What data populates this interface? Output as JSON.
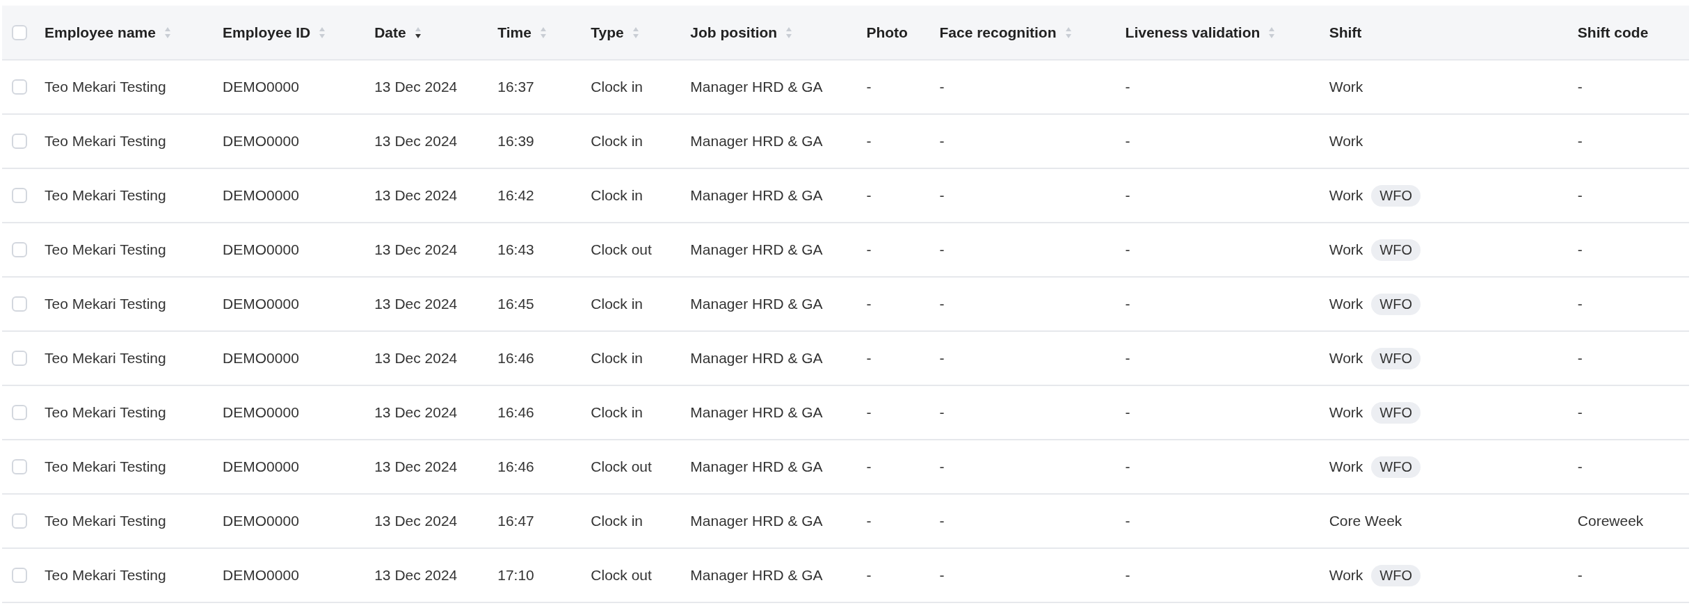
{
  "table": {
    "all_selected": false,
    "columns": [
      {
        "label": "Employee name",
        "kind": "text",
        "sortable": true,
        "sorted": false
      },
      {
        "label": "Employee ID",
        "kind": "text",
        "sortable": true,
        "sorted": false
      },
      {
        "label": "Date",
        "kind": "text",
        "sortable": true,
        "sorted": true
      },
      {
        "label": "Time",
        "kind": "text",
        "sortable": true,
        "sorted": false
      },
      {
        "label": "Type",
        "kind": "text",
        "sortable": true,
        "sorted": false
      },
      {
        "label": "Job position",
        "kind": "text",
        "sortable": true,
        "sorted": false
      },
      {
        "label": "Photo",
        "kind": "text",
        "sortable": false
      },
      {
        "label": "Face recognition",
        "kind": "text",
        "sortable": true,
        "sorted": false
      },
      {
        "label": "Liveness validation",
        "kind": "text",
        "sortable": true,
        "sorted": false
      },
      {
        "label": "Shift",
        "kind": "shift",
        "sortable": false
      },
      {
        "label": "Shift code",
        "kind": "text",
        "sortable": false
      }
    ],
    "rows": [
      {
        "selected": false,
        "cells": [
          "Teo Mekari Testing",
          "DEMO0000",
          "13 Dec 2024",
          "16:37",
          "Clock in",
          "Manager HRD & GA",
          "-",
          "-",
          "-",
          "Work",
          "-"
        ]
      },
      {
        "selected": false,
        "cells": [
          "Teo Mekari Testing",
          "DEMO0000",
          "13 Dec 2024",
          "16:39",
          "Clock in",
          "Manager HRD & GA",
          "-",
          "-",
          "-",
          "Work",
          "-"
        ]
      },
      {
        "selected": false,
        "cells": [
          "Teo Mekari Testing",
          "DEMO0000",
          "13 Dec 2024",
          "16:42",
          "Clock in",
          "Manager HRD & GA",
          "-",
          "-",
          "-",
          "Work",
          "-"
        ],
        "shift_tag": "WFO"
      },
      {
        "selected": false,
        "cells": [
          "Teo Mekari Testing",
          "DEMO0000",
          "13 Dec 2024",
          "16:43",
          "Clock out",
          "Manager HRD & GA",
          "-",
          "-",
          "-",
          "Work",
          "-"
        ],
        "shift_tag": "WFO"
      },
      {
        "selected": false,
        "cells": [
          "Teo Mekari Testing",
          "DEMO0000",
          "13 Dec 2024",
          "16:45",
          "Clock in",
          "Manager HRD & GA",
          "-",
          "-",
          "-",
          "Work",
          "-"
        ],
        "shift_tag": "WFO"
      },
      {
        "selected": false,
        "cells": [
          "Teo Mekari Testing",
          "DEMO0000",
          "13 Dec 2024",
          "16:46",
          "Clock in",
          "Manager HRD & GA",
          "-",
          "-",
          "-",
          "Work",
          "-"
        ],
        "shift_tag": "WFO"
      },
      {
        "selected": false,
        "cells": [
          "Teo Mekari Testing",
          "DEMO0000",
          "13 Dec 2024",
          "16:46",
          "Clock in",
          "Manager HRD & GA",
          "-",
          "-",
          "-",
          "Work",
          "-"
        ],
        "shift_tag": "WFO"
      },
      {
        "selected": false,
        "cells": [
          "Teo Mekari Testing",
          "DEMO0000",
          "13 Dec 2024",
          "16:46",
          "Clock out",
          "Manager HRD & GA",
          "-",
          "-",
          "-",
          "Work",
          "-"
        ],
        "shift_tag": "WFO"
      },
      {
        "selected": false,
        "cells": [
          "Teo Mekari Testing",
          "DEMO0000",
          "13 Dec 2024",
          "16:47",
          "Clock in",
          "Manager HRD & GA",
          "-",
          "-",
          "-",
          "Core Week",
          "Coreweek"
        ]
      },
      {
        "selected": false,
        "cells": [
          "Teo Mekari Testing",
          "DEMO0000",
          "13 Dec 2024",
          "17:10",
          "Clock out",
          "Manager HRD & GA",
          "-",
          "-",
          "-",
          "Work",
          "-"
        ],
        "shift_tag": "WFO"
      }
    ]
  }
}
